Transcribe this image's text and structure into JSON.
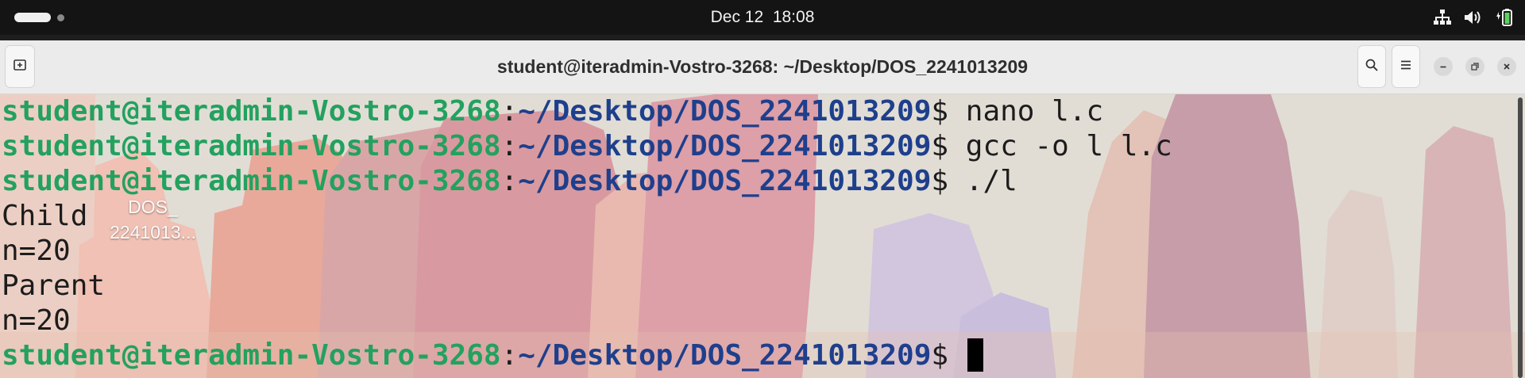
{
  "topbar": {
    "clock": "Dec 12  18:08",
    "icons": [
      "network-icon",
      "volume-icon",
      "battery-icon"
    ]
  },
  "window": {
    "title": "student@iteradmin-Vostro-3268: ~/Desktop/DOS_2241013209",
    "buttons": [
      "new-tab-icon",
      "search-icon",
      "hamburger-menu-icon",
      "minimize-icon",
      "maximize-icon",
      "close-icon"
    ]
  },
  "desktop": {
    "icon_label_line1": "DOS_",
    "icon_label_line2": "2241013..."
  },
  "terminal": {
    "prompt_host": "student@iteradmin-Vostro-3268",
    "prompt_sep": ":",
    "prompt_path": "~/Desktop/DOS_2241013209",
    "prompt_sigil": "$ ",
    "lines": [
      {
        "type": "prompt",
        "command": "nano l.c"
      },
      {
        "type": "prompt",
        "command": "gcc -o l l.c"
      },
      {
        "type": "prompt",
        "command": "./l"
      },
      {
        "type": "output",
        "text": "Child"
      },
      {
        "type": "output",
        "text": "n=20"
      },
      {
        "type": "output",
        "text": "Parent"
      },
      {
        "type": "output",
        "text": "n=20"
      },
      {
        "type": "prompt",
        "command": "",
        "cursor": true
      }
    ]
  },
  "colors": {
    "prompt_host": "#23a15f",
    "prompt_path": "#1e3f8c",
    "topbar_bg": "#141414",
    "titlebar_bg": "#ebebeb"
  }
}
